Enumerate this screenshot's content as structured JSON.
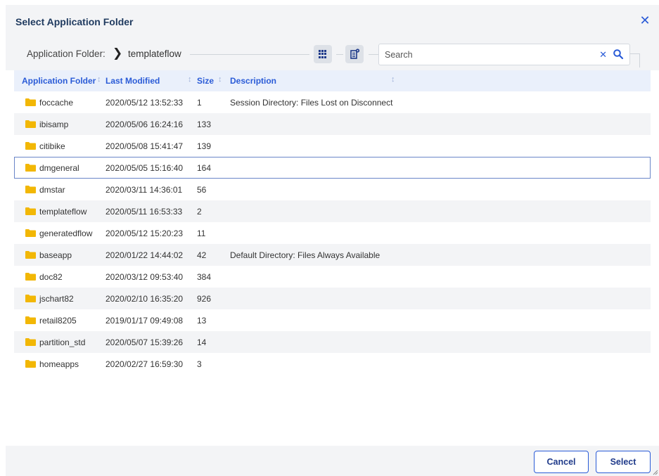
{
  "dialog": {
    "title": "Select Application Folder",
    "close_icon": "close-icon"
  },
  "toolbar": {
    "breadcrumb_label": "Application Folder:",
    "breadcrumb_current": "templateflow",
    "grid_view_icon": "grid-icon",
    "properties_icon": "properties-icon",
    "search_placeholder": "Search",
    "search_value": "",
    "clear_icon": "clear-icon",
    "search_icon": "search-icon"
  },
  "table": {
    "columns": [
      "Application Folder",
      "Last Modified",
      "Size",
      "Description"
    ],
    "rows": [
      {
        "name": "foccache",
        "modified": "2020/05/12 13:52:33",
        "size": "1",
        "description": "Session Directory: Files Lost on Disconnect"
      },
      {
        "name": "ibisamp",
        "modified": "2020/05/06 16:24:16",
        "size": "133",
        "description": ""
      },
      {
        "name": "citibike",
        "modified": "2020/05/08 15:41:47",
        "size": "139",
        "description": ""
      },
      {
        "name": "dmgeneral",
        "modified": "2020/05/05 15:16:40",
        "size": "164",
        "description": ""
      },
      {
        "name": "dmstar",
        "modified": "2020/03/11 14:36:01",
        "size": "56",
        "description": ""
      },
      {
        "name": "templateflow",
        "modified": "2020/05/11 16:53:33",
        "size": "2",
        "description": ""
      },
      {
        "name": "generatedflow",
        "modified": "2020/05/12 15:20:23",
        "size": "11",
        "description": ""
      },
      {
        "name": "baseapp",
        "modified": "2020/01/22 14:44:02",
        "size": "42",
        "description": "Default Directory: Files Always Available"
      },
      {
        "name": "doc82",
        "modified": "2020/03/12 09:53:40",
        "size": "384",
        "description": ""
      },
      {
        "name": "jschart82",
        "modified": "2020/02/10 16:35:20",
        "size": "926",
        "description": ""
      },
      {
        "name": "retail8205",
        "modified": "2019/01/17 09:49:08",
        "size": "13",
        "description": ""
      },
      {
        "name": "partition_std",
        "modified": "2020/05/07 15:39:26",
        "size": "14",
        "description": ""
      },
      {
        "name": "homeapps",
        "modified": "2020/02/27 16:59:30",
        "size": "3",
        "description": ""
      }
    ],
    "selected_row": "dmgeneral"
  },
  "footer": {
    "cancel_label": "Cancel",
    "select_label": "Select"
  },
  "colors": {
    "accent": "#2a5bd7",
    "folder": "#f2b705",
    "header_bg": "#eaf0fb",
    "stripe_bg": "#f3f4f6"
  }
}
